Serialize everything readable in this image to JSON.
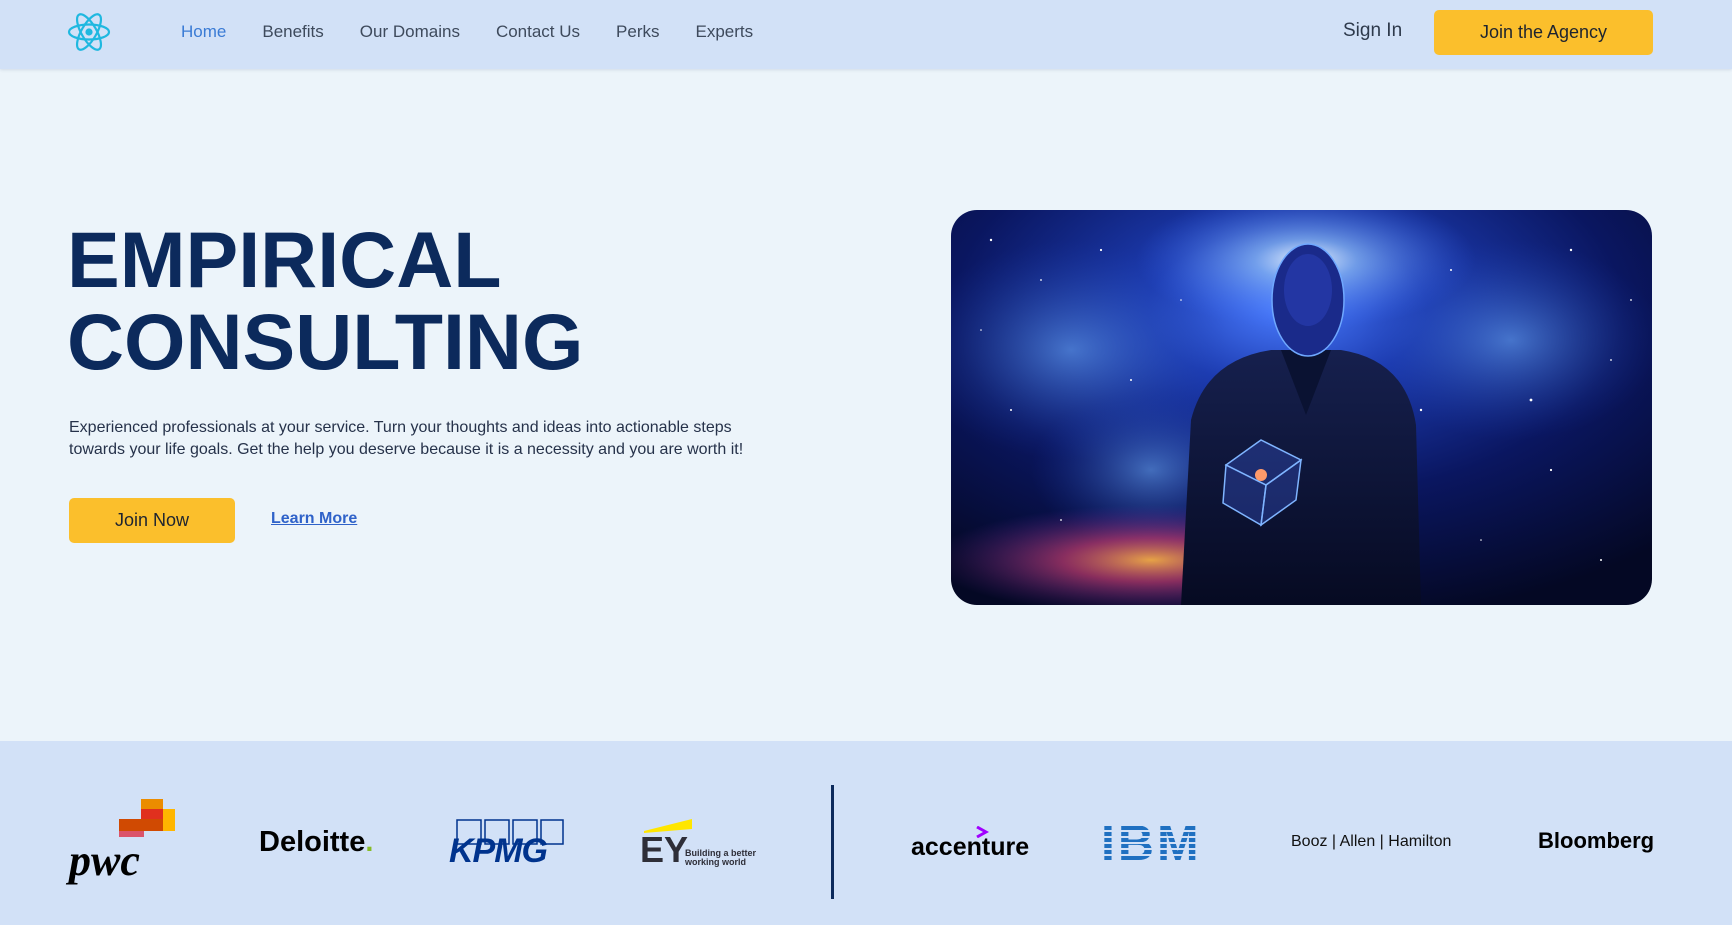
{
  "nav": {
    "logo": "react-atom-icon",
    "links": [
      {
        "label": "Home",
        "active": true
      },
      {
        "label": "Benefits",
        "active": false
      },
      {
        "label": "Our Domains",
        "active": false
      },
      {
        "label": "Contact Us",
        "active": false
      },
      {
        "label": "Perks",
        "active": false
      },
      {
        "label": "Experts",
        "active": false
      }
    ],
    "sign_in": "Sign In",
    "cta": "Join the Agency"
  },
  "hero": {
    "title_line1": "EMPIRICAL",
    "title_line2": "CONSULTING",
    "description": "Experienced professionals at your service. Turn your thoughts and ideas into actionable steps towards your life goals. Get the help you deserve because it is a necessity and you are worth it!",
    "primary_button": "Join Now",
    "secondary_link": "Learn More"
  },
  "partners": {
    "pwc": "pwc",
    "deloitte": "Deloitte",
    "deloitte_dot": ".",
    "kpmg": "KPMG",
    "ey": "EY",
    "ey_tagline_1": "Building a better",
    "ey_tagline_2": "working world",
    "accenture": "accenture",
    "ibm": "IBM",
    "booz": "Booz | Allen | Hamilton",
    "bloomberg": "Bloomberg"
  },
  "colors": {
    "accent": "#fbbf2c",
    "navy": "#0c2a5c",
    "link": "#3a7bd5",
    "nav_bg": "#d2e1f7",
    "page_bg": "#ecf4fa"
  }
}
